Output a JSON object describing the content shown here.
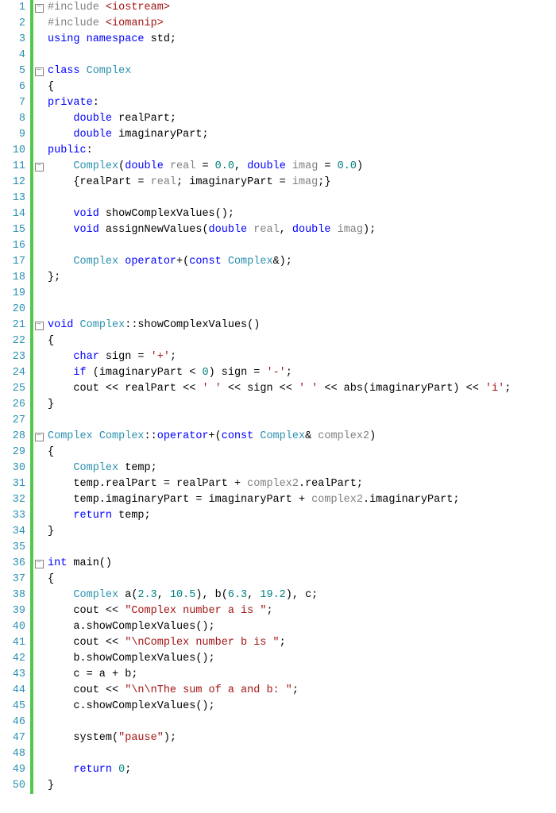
{
  "editor": {
    "lineCount": 50,
    "foldMarkers": {
      "1": "-",
      "5": "-",
      "11": "-",
      "21": "-",
      "28": "-",
      "36": "-"
    },
    "lines": {
      "1": [
        {
          "cls": "pp",
          "t": "#include "
        },
        {
          "cls": "inc",
          "t": "<iostream>"
        }
      ],
      "2": [
        {
          "cls": "pp",
          "t": "#include "
        },
        {
          "cls": "inc",
          "t": "<iomanip>"
        }
      ],
      "3": [
        {
          "cls": "k",
          "t": "using "
        },
        {
          "cls": "k",
          "t": "namespace "
        },
        {
          "cls": "id",
          "t": "std;"
        }
      ],
      "4": [],
      "5": [
        {
          "cls": "k",
          "t": "class "
        },
        {
          "cls": "ty",
          "t": "Complex"
        }
      ],
      "6": [
        {
          "cls": "id",
          "t": "{"
        }
      ],
      "7": [
        {
          "cls": "k",
          "t": "private"
        },
        {
          "cls": "id",
          "t": ":"
        }
      ],
      "8": [
        {
          "cls": "id",
          "t": "    "
        },
        {
          "cls": "k",
          "t": "double "
        },
        {
          "cls": "id",
          "t": "realPart;"
        }
      ],
      "9": [
        {
          "cls": "id",
          "t": "    "
        },
        {
          "cls": "k",
          "t": "double "
        },
        {
          "cls": "id",
          "t": "imaginaryPart;"
        }
      ],
      "10": [
        {
          "cls": "k",
          "t": "public"
        },
        {
          "cls": "id",
          "t": ":"
        }
      ],
      "11": [
        {
          "cls": "id",
          "t": "    "
        },
        {
          "cls": "ty",
          "t": "Complex"
        },
        {
          "cls": "id",
          "t": "("
        },
        {
          "cls": "k",
          "t": "double "
        },
        {
          "cls": "gr",
          "t": "real"
        },
        {
          "cls": "id",
          "t": " = "
        },
        {
          "cls": "lit",
          "t": "0.0"
        },
        {
          "cls": "id",
          "t": ", "
        },
        {
          "cls": "k",
          "t": "double "
        },
        {
          "cls": "gr",
          "t": "imag"
        },
        {
          "cls": "id",
          "t": " = "
        },
        {
          "cls": "lit",
          "t": "0.0"
        },
        {
          "cls": "id",
          "t": ")"
        }
      ],
      "12": [
        {
          "cls": "id",
          "t": "    {realPart = "
        },
        {
          "cls": "gr",
          "t": "real"
        },
        {
          "cls": "id",
          "t": "; imaginaryPart = "
        },
        {
          "cls": "gr",
          "t": "imag"
        },
        {
          "cls": "id",
          "t": ";}"
        }
      ],
      "13": [],
      "14": [
        {
          "cls": "id",
          "t": "    "
        },
        {
          "cls": "k",
          "t": "void "
        },
        {
          "cls": "id",
          "t": "showComplexValues();"
        }
      ],
      "15": [
        {
          "cls": "id",
          "t": "    "
        },
        {
          "cls": "k",
          "t": "void "
        },
        {
          "cls": "id",
          "t": "assignNewValues("
        },
        {
          "cls": "k",
          "t": "double "
        },
        {
          "cls": "gr",
          "t": "real"
        },
        {
          "cls": "id",
          "t": ", "
        },
        {
          "cls": "k",
          "t": "double "
        },
        {
          "cls": "gr",
          "t": "imag"
        },
        {
          "cls": "id",
          "t": ");"
        }
      ],
      "16": [],
      "17": [
        {
          "cls": "id",
          "t": "    "
        },
        {
          "cls": "ty",
          "t": "Complex "
        },
        {
          "cls": "k",
          "t": "operator"
        },
        {
          "cls": "id",
          "t": "+("
        },
        {
          "cls": "k",
          "t": "const "
        },
        {
          "cls": "ty",
          "t": "Complex"
        },
        {
          "cls": "id",
          "t": "&);"
        }
      ],
      "18": [
        {
          "cls": "id",
          "t": "};"
        }
      ],
      "19": [],
      "20": [],
      "21": [
        {
          "cls": "k",
          "t": "void "
        },
        {
          "cls": "ty",
          "t": "Complex"
        },
        {
          "cls": "id",
          "t": "::showComplexValues()"
        }
      ],
      "22": [
        {
          "cls": "id",
          "t": "{"
        }
      ],
      "23": [
        {
          "cls": "id",
          "t": "    "
        },
        {
          "cls": "k",
          "t": "char "
        },
        {
          "cls": "id",
          "t": "sign = "
        },
        {
          "cls": "ch",
          "t": "'+'"
        },
        {
          "cls": "id",
          "t": ";"
        }
      ],
      "24": [
        {
          "cls": "id",
          "t": "    "
        },
        {
          "cls": "k",
          "t": "if "
        },
        {
          "cls": "id",
          "t": "(imaginaryPart < "
        },
        {
          "cls": "lit",
          "t": "0"
        },
        {
          "cls": "id",
          "t": ") sign = "
        },
        {
          "cls": "ch",
          "t": "'-'"
        },
        {
          "cls": "id",
          "t": ";"
        }
      ],
      "25": [
        {
          "cls": "id",
          "t": "    cout << realPart << "
        },
        {
          "cls": "ch",
          "t": "' '"
        },
        {
          "cls": "id",
          "t": " << sign << "
        },
        {
          "cls": "ch",
          "t": "' '"
        },
        {
          "cls": "id",
          "t": " << abs(imaginaryPart) << "
        },
        {
          "cls": "ch",
          "t": "'i'"
        },
        {
          "cls": "id",
          "t": ";"
        }
      ],
      "26": [
        {
          "cls": "id",
          "t": "}"
        }
      ],
      "27": [],
      "28": [
        {
          "cls": "ty",
          "t": "Complex "
        },
        {
          "cls": "ty",
          "t": "Complex"
        },
        {
          "cls": "id",
          "t": "::"
        },
        {
          "cls": "k",
          "t": "operator"
        },
        {
          "cls": "id",
          "t": "+("
        },
        {
          "cls": "k",
          "t": "const "
        },
        {
          "cls": "ty",
          "t": "Complex"
        },
        {
          "cls": "id",
          "t": "& "
        },
        {
          "cls": "gr",
          "t": "complex2"
        },
        {
          "cls": "id",
          "t": ")"
        }
      ],
      "29": [
        {
          "cls": "id",
          "t": "{"
        }
      ],
      "30": [
        {
          "cls": "id",
          "t": "    "
        },
        {
          "cls": "ty",
          "t": "Complex "
        },
        {
          "cls": "id",
          "t": "temp;"
        }
      ],
      "31": [
        {
          "cls": "id",
          "t": "    temp.realPart = realPart + "
        },
        {
          "cls": "gr",
          "t": "complex2"
        },
        {
          "cls": "id",
          "t": ".realPart;"
        }
      ],
      "32": [
        {
          "cls": "id",
          "t": "    temp.imaginaryPart = imaginaryPart + "
        },
        {
          "cls": "gr",
          "t": "complex2"
        },
        {
          "cls": "id",
          "t": ".imaginaryPart;"
        }
      ],
      "33": [
        {
          "cls": "id",
          "t": "    "
        },
        {
          "cls": "k",
          "t": "return "
        },
        {
          "cls": "id",
          "t": "temp;"
        }
      ],
      "34": [
        {
          "cls": "id",
          "t": "}"
        }
      ],
      "35": [],
      "36": [
        {
          "cls": "k",
          "t": "int "
        },
        {
          "cls": "id",
          "t": "main()"
        }
      ],
      "37": [
        {
          "cls": "id",
          "t": "{"
        }
      ],
      "38": [
        {
          "cls": "id",
          "t": "    "
        },
        {
          "cls": "ty",
          "t": "Complex "
        },
        {
          "cls": "id",
          "t": "a("
        },
        {
          "cls": "lit",
          "t": "2.3"
        },
        {
          "cls": "id",
          "t": ", "
        },
        {
          "cls": "lit",
          "t": "10.5"
        },
        {
          "cls": "id",
          "t": "), b("
        },
        {
          "cls": "lit",
          "t": "6.3"
        },
        {
          "cls": "id",
          "t": ", "
        },
        {
          "cls": "lit",
          "t": "19.2"
        },
        {
          "cls": "id",
          "t": "), c;"
        }
      ],
      "39": [
        {
          "cls": "id",
          "t": "    cout << "
        },
        {
          "cls": "str",
          "t": "\"Complex number a is \""
        },
        {
          "cls": "id",
          "t": ";"
        }
      ],
      "40": [
        {
          "cls": "id",
          "t": "    a.showComplexValues();"
        }
      ],
      "41": [
        {
          "cls": "id",
          "t": "    cout << "
        },
        {
          "cls": "str",
          "t": "\"\\nComplex number b is \""
        },
        {
          "cls": "id",
          "t": ";"
        }
      ],
      "42": [
        {
          "cls": "id",
          "t": "    b.showComplexValues();"
        }
      ],
      "43": [
        {
          "cls": "id",
          "t": "    c = a + b;"
        }
      ],
      "44": [
        {
          "cls": "id",
          "t": "    cout << "
        },
        {
          "cls": "str",
          "t": "\"\\n\\nThe sum of a and b: \""
        },
        {
          "cls": "id",
          "t": ";"
        }
      ],
      "45": [
        {
          "cls": "id",
          "t": "    c.showComplexValues();"
        }
      ],
      "46": [],
      "47": [
        {
          "cls": "id",
          "t": "    system("
        },
        {
          "cls": "str",
          "t": "\"pause\""
        },
        {
          "cls": "id",
          "t": ");"
        }
      ],
      "48": [],
      "49": [
        {
          "cls": "id",
          "t": "    "
        },
        {
          "cls": "k",
          "t": "return "
        },
        {
          "cls": "lit",
          "t": "0"
        },
        {
          "cls": "id",
          "t": ";"
        }
      ],
      "50": [
        {
          "cls": "id",
          "t": "}"
        }
      ]
    }
  }
}
